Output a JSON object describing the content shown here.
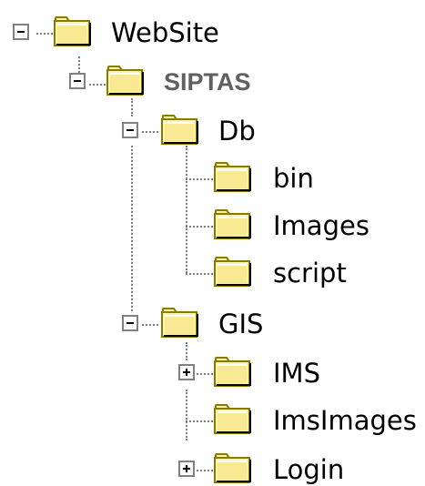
{
  "tree": {
    "nodes": [
      {
        "label": "WebSite",
        "state": "expanded",
        "icon": "folder-icon"
      },
      {
        "label": "SIPTAS",
        "state": "expanded",
        "icon": "folder-icon"
      },
      {
        "label": "Db",
        "state": "expanded",
        "icon": "folder-icon"
      },
      {
        "label": "bin",
        "state": "leaf",
        "icon": "folder-icon"
      },
      {
        "label": "Images",
        "state": "leaf",
        "icon": "folder-icon"
      },
      {
        "label": "script",
        "state": "leaf",
        "icon": "folder-icon"
      },
      {
        "label": "GIS",
        "state": "expanded",
        "icon": "folder-icon"
      },
      {
        "label": "IMS",
        "state": "collapsed",
        "icon": "folder-icon"
      },
      {
        "label": "ImsImages",
        "state": "leaf",
        "icon": "folder-icon"
      },
      {
        "label": "Login",
        "state": "collapsed",
        "icon": "folder-icon"
      }
    ]
  },
  "colors": {
    "folder_fill": "#fff3b0",
    "folder_outline": "#8a7a00",
    "connector": "#808080",
    "siptas_label": "#606060"
  }
}
